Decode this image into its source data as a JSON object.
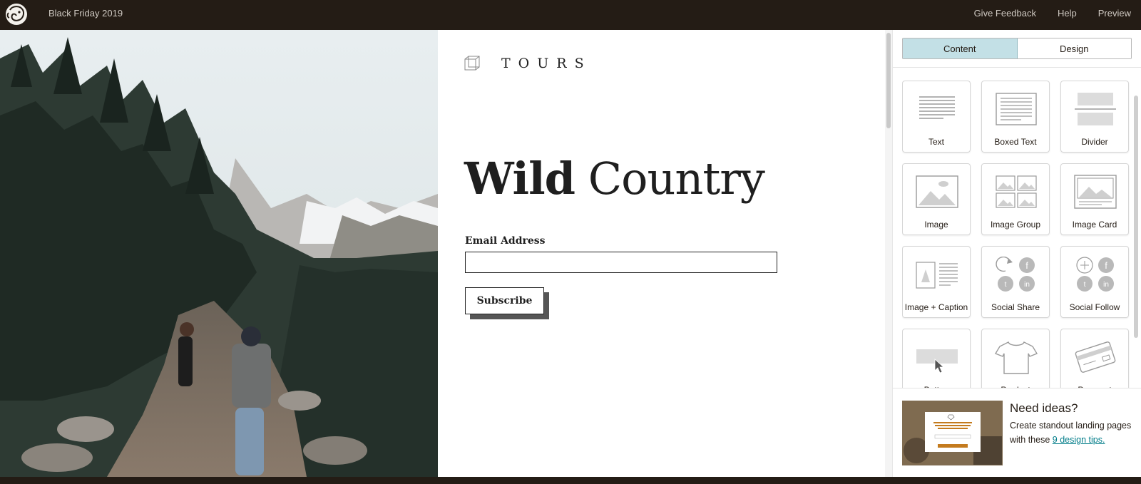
{
  "topbar": {
    "logo_icon": "mailchimp-freddie-icon",
    "campaign_title": "Black Friday 2019",
    "links": [
      "Give Feedback",
      "Help",
      "Preview"
    ]
  },
  "canvas": {
    "brand_icon": "cube-outline-icon",
    "brand_text": "TOURS",
    "headline_bold": "Wild",
    "headline_light": "Country",
    "email_label": "Email Address",
    "email_value": "",
    "subscribe_label": "Subscribe"
  },
  "panel": {
    "tabs": [
      {
        "label": "Content",
        "active": true
      },
      {
        "label": "Design",
        "active": false
      }
    ],
    "blocks": [
      {
        "label": "Text",
        "icon": "text-block-icon"
      },
      {
        "label": "Boxed Text",
        "icon": "boxed-text-block-icon"
      },
      {
        "label": "Divider",
        "icon": "divider-block-icon"
      },
      {
        "label": "Image",
        "icon": "image-block-icon"
      },
      {
        "label": "Image Group",
        "icon": "image-group-block-icon"
      },
      {
        "label": "Image Card",
        "icon": "image-card-block-icon"
      },
      {
        "label": "Image + Caption",
        "icon": "image-caption-block-icon"
      },
      {
        "label": "Social Share",
        "icon": "social-share-block-icon"
      },
      {
        "label": "Social Follow",
        "icon": "social-follow-block-icon"
      },
      {
        "label": "Button",
        "icon": "button-block-icon"
      },
      {
        "label": "Product",
        "icon": "product-tshirt-icon"
      },
      {
        "label": "Payment",
        "icon": "payment-card-icon"
      }
    ],
    "ideas": {
      "title": "Need ideas?",
      "body": "Create standout landing pages with these",
      "link": "9 design tips."
    }
  },
  "colors": {
    "topbar": "#241c15",
    "active_tab": "#c3e0e6",
    "link": "#007c89"
  }
}
